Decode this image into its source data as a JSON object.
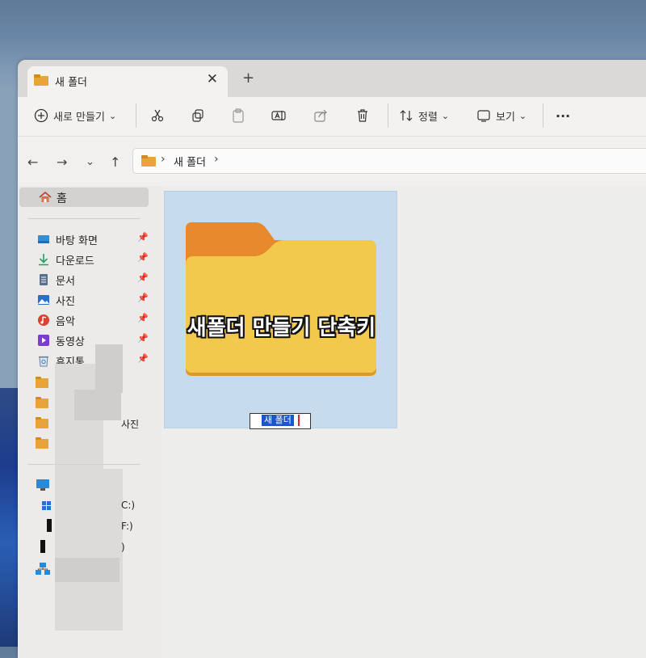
{
  "window": {
    "tab_title": "새 폴더",
    "tab_close": "✕",
    "new_tab": "+"
  },
  "toolbar": {
    "new_label": "새로 만들기",
    "sort_label": "정렬",
    "view_label": "보기",
    "more_label": "···",
    "chevron": "⌄"
  },
  "nav": {
    "back": "←",
    "forward": "→",
    "recent": "⌄",
    "up": "↑"
  },
  "address": {
    "separator": "›",
    "path": "새 폴더"
  },
  "sidebar": {
    "home_label": "홈",
    "pinned": [
      {
        "label": "바탕 화면",
        "icon": "desktop-icon"
      },
      {
        "label": "다운로드",
        "icon": "download-icon"
      },
      {
        "label": "문서",
        "icon": "document-icon"
      },
      {
        "label": "사진",
        "icon": "pictures-icon"
      },
      {
        "label": "음악",
        "icon": "music-icon"
      },
      {
        "label": "동영상",
        "icon": "video-icon"
      },
      {
        "label": "휴지통",
        "icon": "recycle-bin-icon"
      }
    ],
    "pin_glyph": "📌",
    "fragment_photos": "사진",
    "drive_fragments": [
      "C:)",
      "F:)",
      ")"
    ]
  },
  "main": {
    "folder_name": "새 폴더",
    "overlay_caption": "새폴더 만들기 단축키"
  },
  "colors": {
    "folder_front": "#f2c94c",
    "folder_back": "#e8892b",
    "selection": "#c6dbec",
    "rename_highlight": "#1a56c9"
  }
}
